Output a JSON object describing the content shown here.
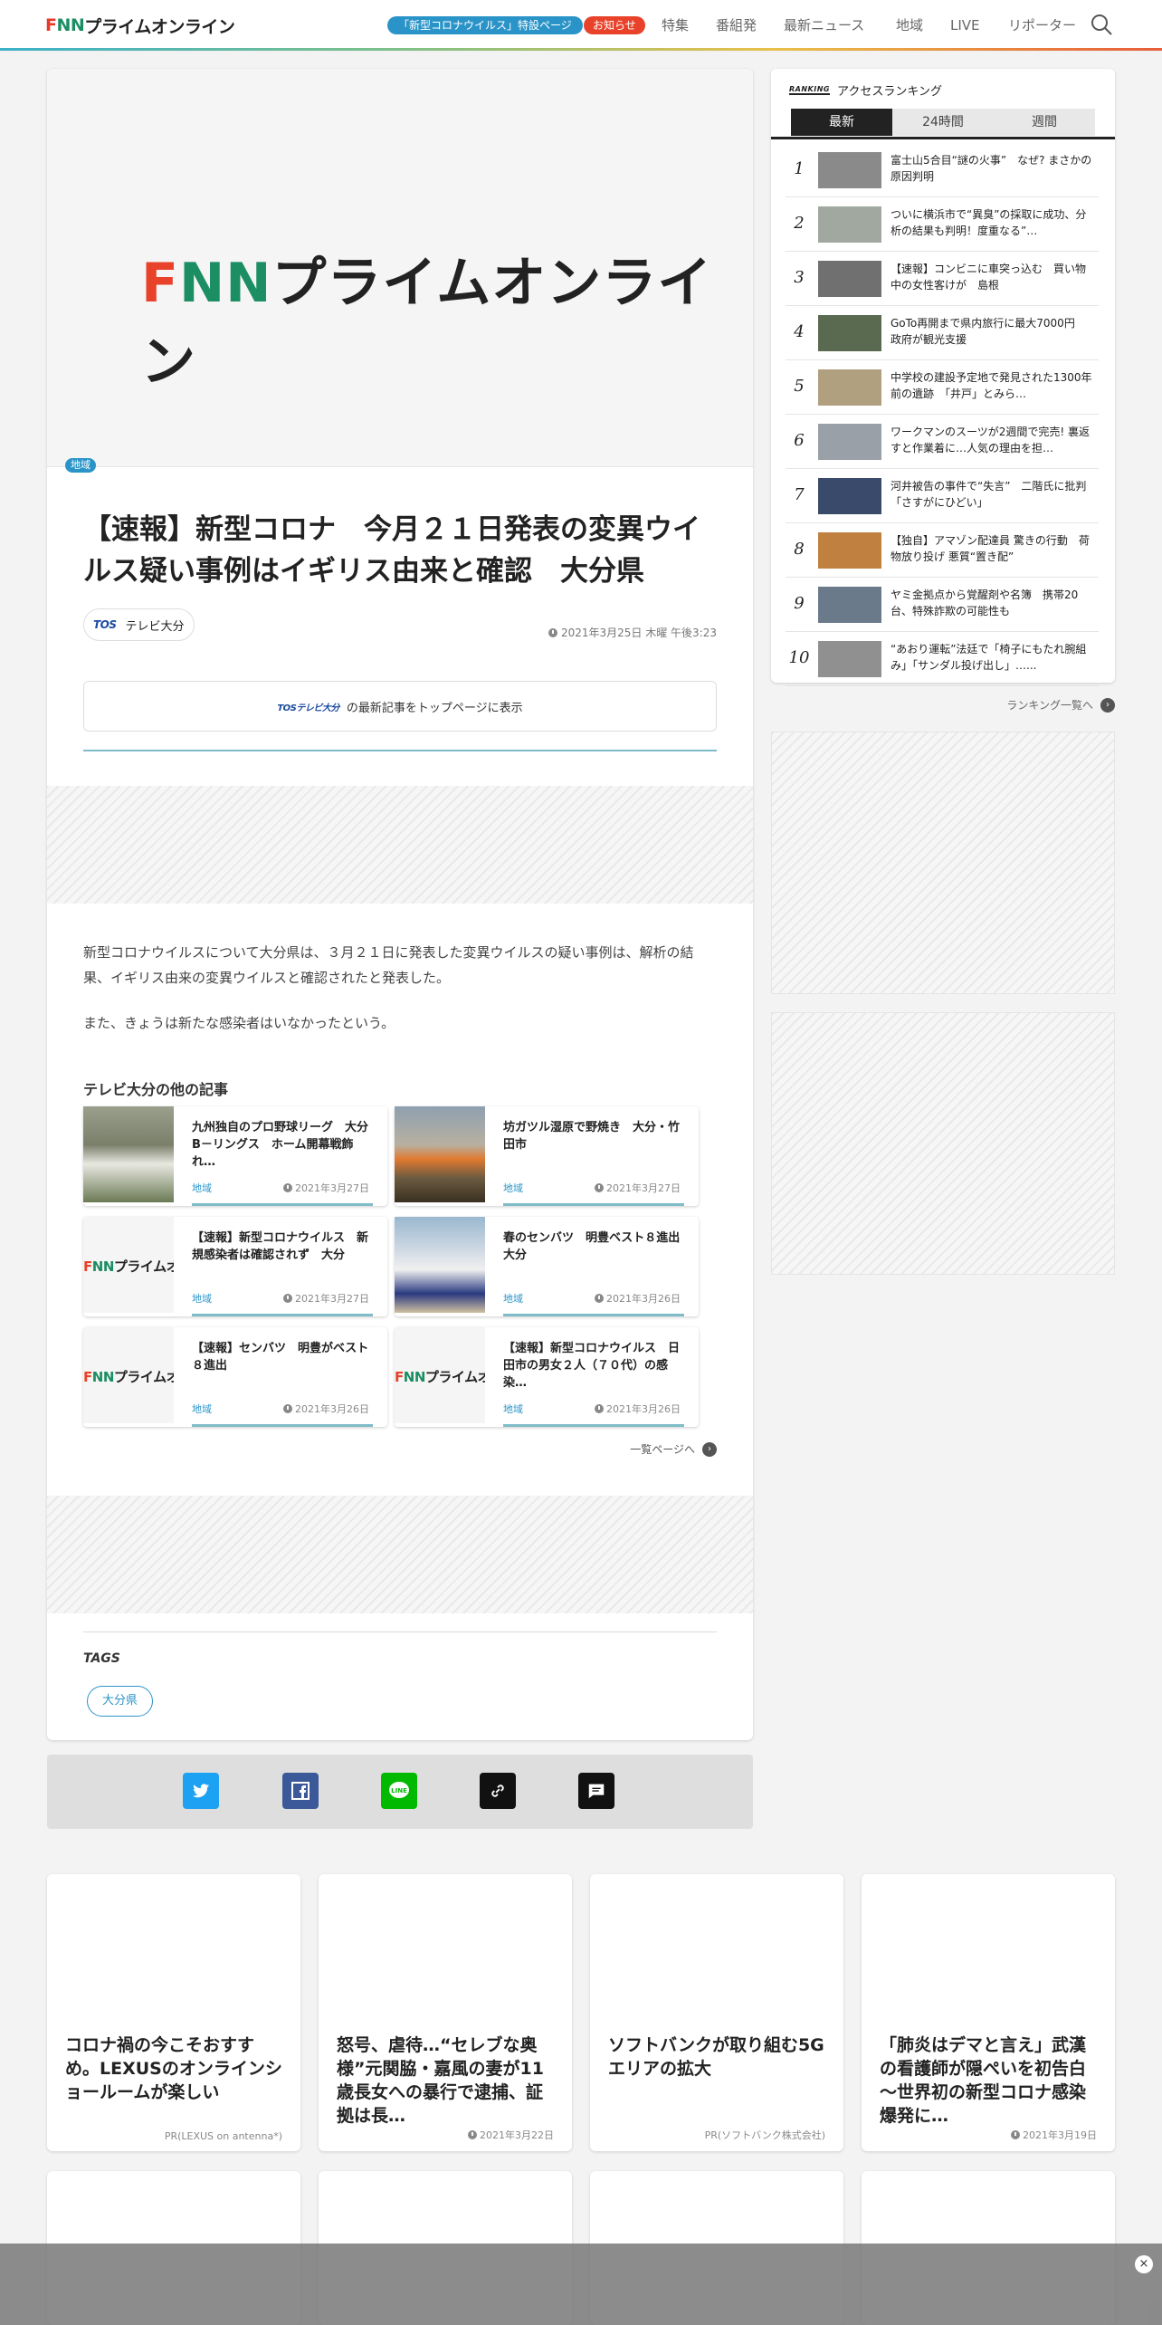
{
  "header": {
    "logo_f": "F",
    "logo_n1": "N",
    "logo_n2": "N",
    "logo_text": "プライムオンライン",
    "corona_pill": "「新型コロナウイルス」特設ページ",
    "notice_pill": "お知らせ",
    "nav": [
      "特集",
      "番組発",
      "最新ニュース",
      "地域",
      "LIVE",
      "リポーター"
    ]
  },
  "article": {
    "category": "地域",
    "title": "【速報】新型コロナ　今月２１日発表の変異ウイルス疑い事例はイギリス由来と確認　大分県",
    "source_logo": "TOS",
    "source_name": "テレビ大分",
    "date": "2021年3月25日 木曜 午後3:23",
    "follow_logo": "TOSテレビ大分",
    "follow_text": "の最新記事をトップページに表示",
    "body1": "新型コロナウイルスについて大分県は、３月２１日に発表した変異ウイルスの疑い事例は、解析の結果、イギリス由来の変異ウイルスと確認されたと発表した。",
    "body2": "また、きょうは新たな感染者はいなかったという。",
    "other_heading": "テレビ大分の他の記事",
    "related": [
      {
        "title": "九州独自のプロ野球リーグ　大分B－リングス　ホーム開幕戦飾れ…",
        "cat": "地域",
        "date": "2021年3月27日"
      },
      {
        "title": "坊ガツル湿原で野焼き　大分・竹田市",
        "cat": "地域",
        "date": "2021年3月27日"
      },
      {
        "title": "【速報】新型コロナウイルス　新規感染者は確認されず　大分",
        "cat": "地域",
        "date": "2021年3月27日"
      },
      {
        "title": "春のセンバツ　明豊ベスト８進出　大分",
        "cat": "地域",
        "date": "2021年3月26日"
      },
      {
        "title": "【速報】センバツ　明豊がベスト８進出",
        "cat": "地域",
        "date": "2021年3月26日"
      },
      {
        "title": "【速報】新型コロナウイルス　日田市の男女２人（７０代）の感染…",
        "cat": "地域",
        "date": "2021年3月26日"
      }
    ],
    "list_link": "一覧ページへ",
    "tags_heading": "TAGS",
    "tag": "大分県"
  },
  "ranking": {
    "badge": "RANKING",
    "heading": "アクセスランキング",
    "tabs": [
      "最新",
      "24時間",
      "週間"
    ],
    "items": [
      {
        "num": "1",
        "text": "富士山5合目“謎の火事”　なぜ? まさかの原因判明"
      },
      {
        "num": "2",
        "text": "ついに横浜市で“異臭”の採取に成功、分析の結果も判明！度重なる”…"
      },
      {
        "num": "3",
        "text": "【速報】コンビニに車突っ込む　買い物中の女性客けが　島根"
      },
      {
        "num": "4",
        "text": "GoTo再開まで県内旅行に最大7000円　政府が観光支援"
      },
      {
        "num": "5",
        "text": "中学校の建設予定地で発見された1300年前の遺跡　「井戸」とみら…"
      },
      {
        "num": "6",
        "text": "ワークマンのスーツが2週間で完売! 裏返すと作業着に…人気の理由を担…"
      },
      {
        "num": "7",
        "text": "河井被告の事件で“失言”　二階氏に批判「さすがにひどい」"
      },
      {
        "num": "8",
        "text": "【独自】アマゾン配達員 驚きの行動　荷物放り投げ 悪質“置き配”"
      },
      {
        "num": "9",
        "text": "ヤミ金拠点から覚醒剤や名簿　携帯20台、特殊詐欺の可能性も"
      },
      {
        "num": "10",
        "text": "“あおり運転”法廷で「椅子にもたれ腕組み」「サンダル投げ出し」…..."
      }
    ],
    "more_link": "ランキング一覧へ"
  },
  "bottom_cards": [
    {
      "title": "コロナ禍の今こそおすすめ。LEXUSのオンラインショールームが楽しい",
      "foot": "PR(LEXUS on antenna*)"
    },
    {
      "title": "怒号、虐待…“セレブな奥様”元関脇・嘉風の妻が11歳長女への暴行で逮捕、証拠は長…",
      "foot": "2021年3月22日"
    },
    {
      "title": "ソフトバンクが取り組む5Gエリアの拡大",
      "foot": "PR(ソフトバンク株式会社)"
    },
    {
      "title": "「肺炎はデマと言え」武漢の看護師が隠ぺいを初告白　～世界初の新型コロナ感染爆発に…",
      "foot": "2021年3月19日"
    }
  ],
  "overlay": {
    "close": "×"
  }
}
